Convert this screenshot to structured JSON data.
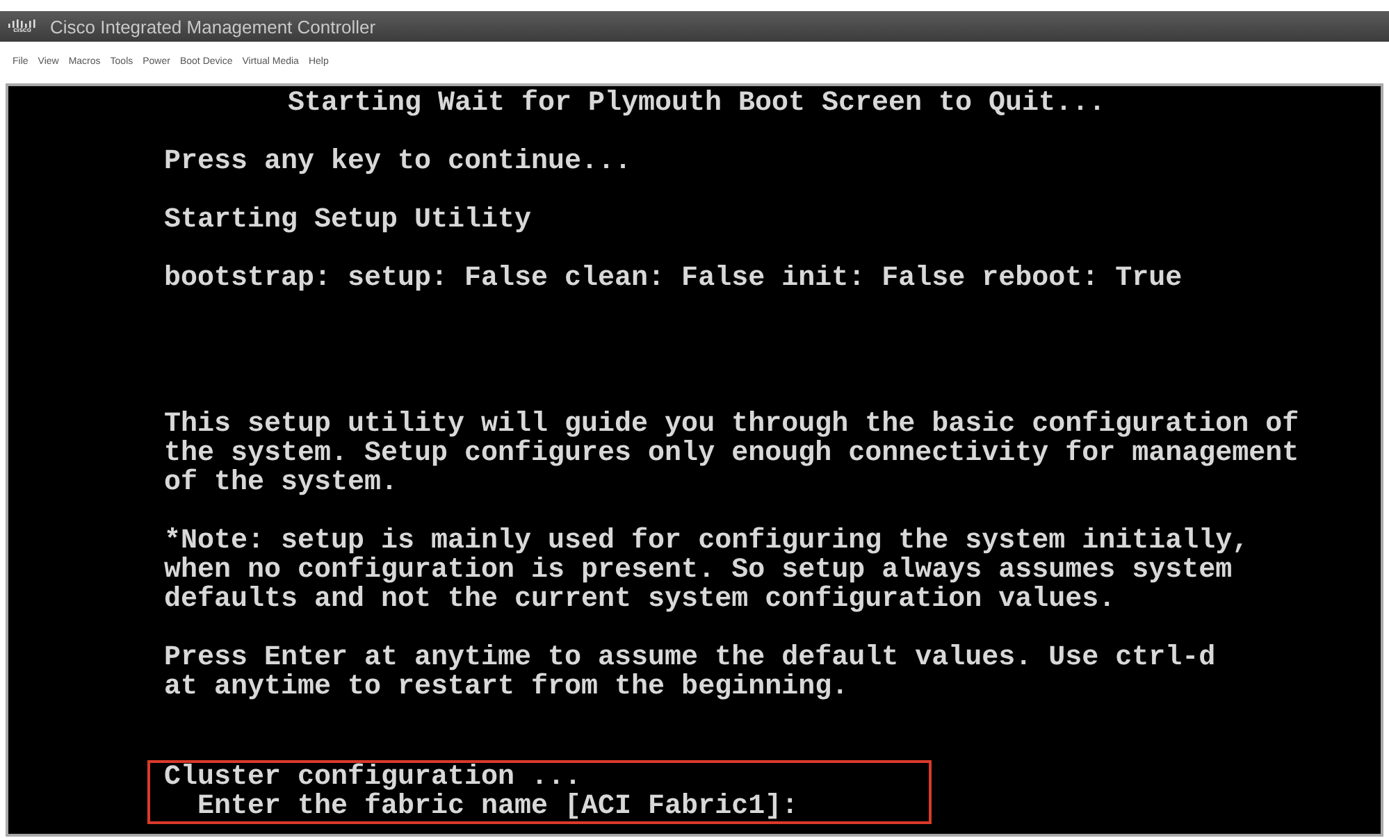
{
  "window": {
    "title": "Cisco Integrated Management Controller",
    "logo": "cisco"
  },
  "menu": [
    "File",
    "View",
    "Macros",
    "Tools",
    "Power",
    "Boot Device",
    "Virtual Media",
    "Help"
  ],
  "console": {
    "paragraphs": [
      {
        "kind": "heading",
        "highlighted": false,
        "lines": [
          "Starting Wait for Plymouth Boot Screen to Quit..."
        ]
      },
      {
        "kind": "text",
        "highlighted": false,
        "lines": [
          "Press any key to continue..."
        ]
      },
      {
        "kind": "text",
        "highlighted": false,
        "lines": [
          "Starting Setup Utility"
        ]
      },
      {
        "kind": "text",
        "highlighted": false,
        "lines": [
          "bootstrap: setup: False clean: False init: False reboot: True"
        ]
      },
      {
        "kind": "text",
        "highlighted": false,
        "lines": [
          "This setup utility will guide you through the basic configuration of",
          "the system. Setup configures only enough connectivity for management",
          "of the system."
        ]
      },
      {
        "kind": "text",
        "highlighted": false,
        "lines": [
          "*Note: setup is mainly used for configuring the system initially,",
          "when no configuration is present. So setup always assumes system",
          "defaults and not the current system configuration values."
        ]
      },
      {
        "kind": "text",
        "highlighted": false,
        "lines": [
          "Press Enter at anytime to assume the default values. Use ctrl-d",
          "at anytime to restart from the beginning."
        ]
      },
      {
        "kind": "text",
        "highlighted": true,
        "lines": [
          "Cluster configuration ...",
          "  Enter the fabric name [ACI Fabric1]:"
        ]
      }
    ]
  }
}
